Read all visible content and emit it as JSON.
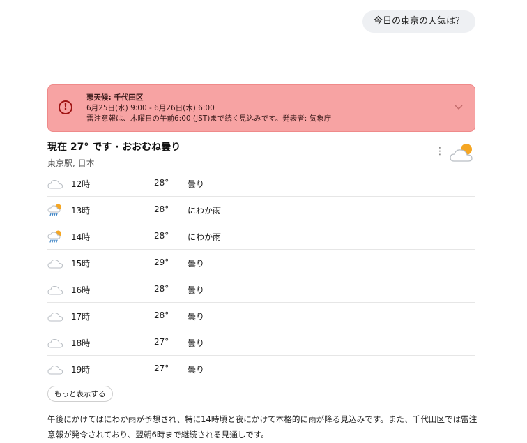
{
  "user_message": "今日の東京の天気は？",
  "alert": {
    "title": "悪天候: 千代田区",
    "period": "6月25日(水) 9:00 - 6月26日(木) 6:00",
    "detail": "雷注意報は、木曜日の午前6:00 (JST)まで続く見込みです。発表者: 気象庁",
    "icon": "alert-circle-icon",
    "colors": {
      "background": "#f7a3a3",
      "icon": "#a01414"
    }
  },
  "current": {
    "title": "現在 27° です · おおむね曇り",
    "location": "東京駅, 日本",
    "icon": "partly-cloudy-icon"
  },
  "hourly": [
    {
      "time": "12時",
      "temp": "28°",
      "condition": "曇り",
      "icon": "cloud"
    },
    {
      "time": "13時",
      "temp": "28°",
      "condition": "にわか雨",
      "icon": "sun-rain"
    },
    {
      "time": "14時",
      "temp": "28°",
      "condition": "にわか雨",
      "icon": "sun-rain"
    },
    {
      "time": "15時",
      "temp": "29°",
      "condition": "曇り",
      "icon": "cloud"
    },
    {
      "time": "16時",
      "temp": "28°",
      "condition": "曇り",
      "icon": "cloud"
    },
    {
      "time": "17時",
      "temp": "28°",
      "condition": "曇り",
      "icon": "cloud"
    },
    {
      "time": "18時",
      "temp": "27°",
      "condition": "曇り",
      "icon": "cloud"
    },
    {
      "time": "19時",
      "temp": "27°",
      "condition": "曇り",
      "icon": "cloud"
    }
  ],
  "show_more_label": "もっと表示する",
  "summary": "午後にかけてはにわか雨が予想され、特に14時頃と夜にかけて本格的に雨が降る見込みです。また、千代田区では雷注意報が発令されており、翌朝6時まで継続される見通しです。"
}
